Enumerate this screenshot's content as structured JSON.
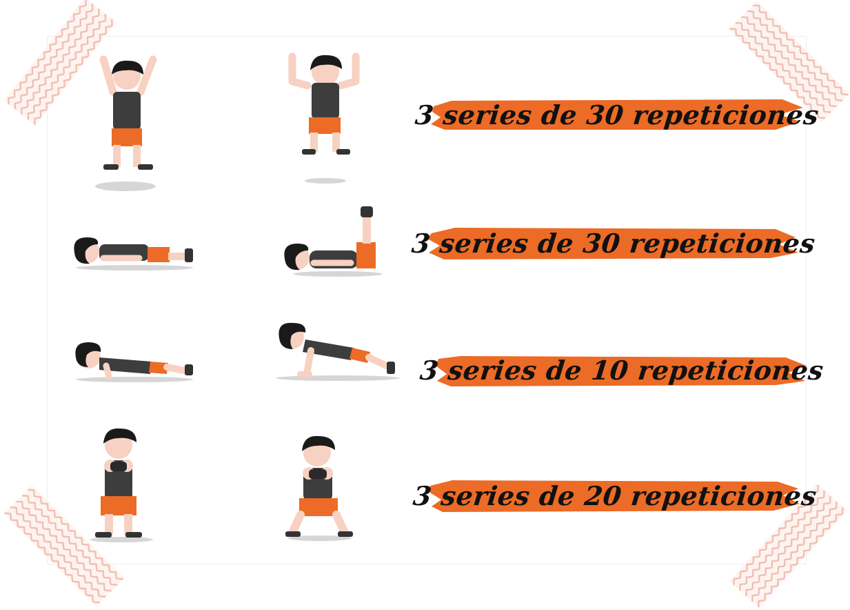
{
  "colors": {
    "accent": "#ec6b26",
    "shirt": "#3d3d3d",
    "shorts": "#ec6b26",
    "skin": "#f7d1c2",
    "hair": "#1a1a1a",
    "shoe": "#333333",
    "tape": "#f0b3a3",
    "text": "#111111"
  },
  "exercises": [
    {
      "label": "3 series de 30 repeticiones"
    },
    {
      "label": "3 series de 30 repeticiones"
    },
    {
      "label": "3 series de 10 repeticiones"
    },
    {
      "label": "3 series de 20 repeticiones"
    }
  ]
}
